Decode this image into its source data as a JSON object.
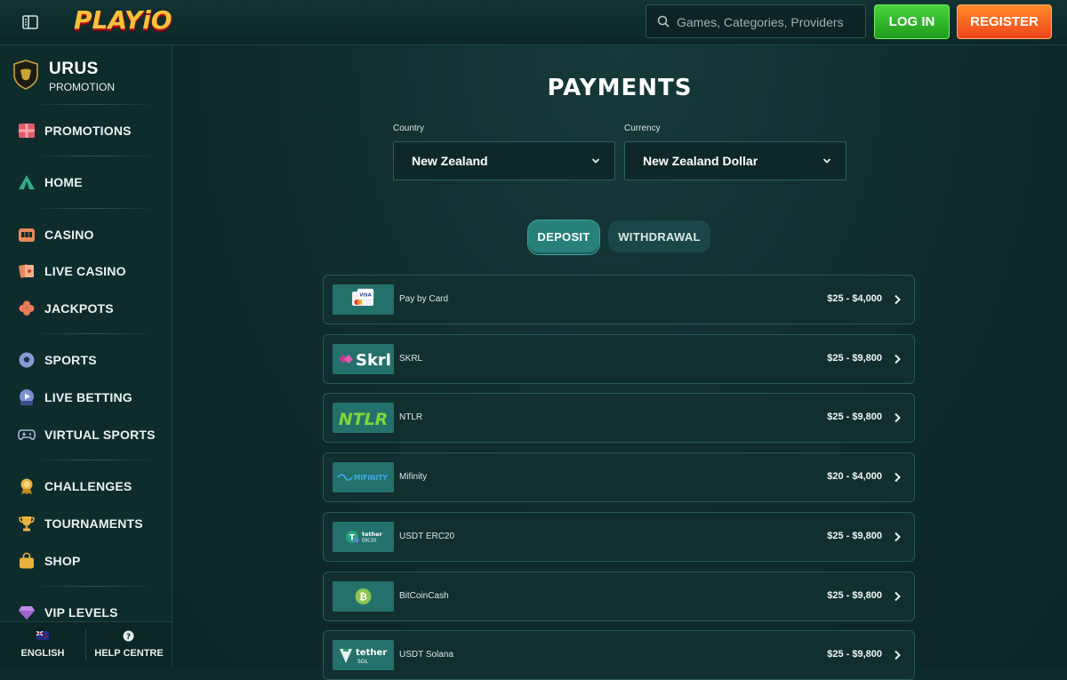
{
  "header": {
    "logo": "PLAYiO",
    "search_placeholder": "Games, Categories, Providers",
    "login_label": "LOG IN",
    "register_label": "REGISTER"
  },
  "sidebar": {
    "promo_title": "URUS",
    "promo_subtitle": "PROMOTION",
    "items": [
      {
        "label": "PROMOTIONS",
        "icon": "gift-icon"
      },
      {
        "label": "HOME",
        "icon": "tent-icon"
      },
      {
        "label": "CASINO",
        "icon": "slot-machine-icon"
      },
      {
        "label": "LIVE CASINO",
        "icon": "cards-icon"
      },
      {
        "label": "JACKPOTS",
        "icon": "clover-icon"
      },
      {
        "label": "SPORTS",
        "icon": "soccer-ball-icon"
      },
      {
        "label": "LIVE BETTING",
        "icon": "live-play-icon"
      },
      {
        "label": "VIRTUAL SPORTS",
        "icon": "gamepad-icon"
      },
      {
        "label": "CHALLENGES",
        "icon": "medal-icon"
      },
      {
        "label": "TOURNAMENTS",
        "icon": "trophy-icon"
      },
      {
        "label": "SHOP",
        "icon": "shopping-bag-icon"
      },
      {
        "label": "VIP LEVELS",
        "icon": "diamond-icon"
      }
    ],
    "footer": {
      "language_label": "ENGLISH",
      "help_label": "HELP CENTRE"
    }
  },
  "main": {
    "title": "PAYMENTS",
    "country_label": "Country",
    "country_value": "New Zealand",
    "currency_label": "Currency",
    "currency_value": "New Zealand Dollar",
    "tabs": [
      {
        "label": "DEPOSIT",
        "active": true
      },
      {
        "label": "WITHDRAWAL",
        "active": false
      }
    ],
    "payments": [
      {
        "name": "Pay by Card",
        "range": "$25 - $4,000",
        "logo_text": "VISA"
      },
      {
        "name": "SKRL",
        "range": "$25 - $9,800",
        "logo_text": "Skrl"
      },
      {
        "name": "NTLR",
        "range": "$25 - $9,800",
        "logo_text": "NTLR"
      },
      {
        "name": "Mifinity",
        "range": "$20 - $4,000",
        "logo_text": "MIFINITY"
      },
      {
        "name": "USDT ERC20",
        "range": "$25 - $9,800",
        "logo_text": "tether",
        "logo_sub": "ERC20"
      },
      {
        "name": "BitCoinCash",
        "range": "$25 - $9,800",
        "logo_text": "₿"
      },
      {
        "name": "USDT Solana",
        "range": "$25 - $9,800",
        "logo_text": "tether",
        "logo_sub": "SOL"
      }
    ]
  },
  "colors": {
    "background": "#0f2a2a",
    "accent_teal": "#27807a",
    "login_green": "#2fb52a",
    "register_orange": "#f5611f"
  }
}
